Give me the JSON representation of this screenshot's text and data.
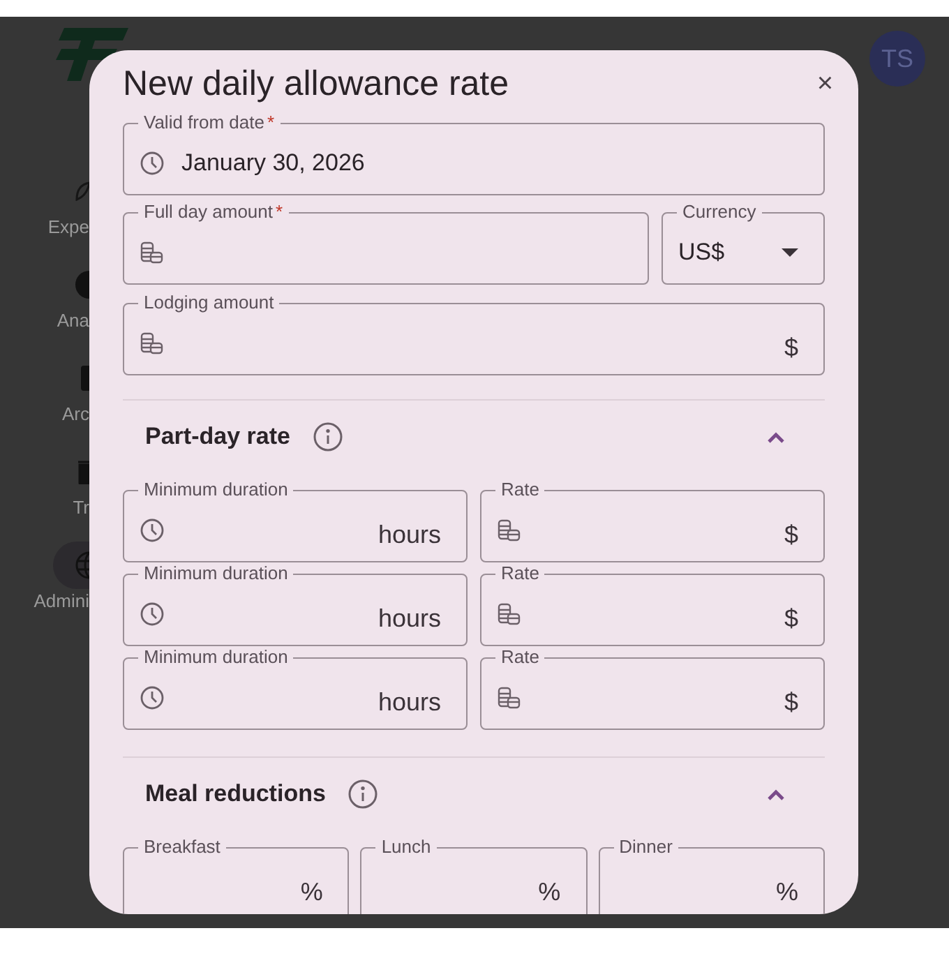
{
  "background": {
    "sidebar_items": [
      {
        "label": "Expe",
        "kind": "leaf",
        "selected": false
      },
      {
        "label": "Ana",
        "kind": "circle",
        "selected": false
      },
      {
        "label": "Arc",
        "kind": "box",
        "selected": false
      },
      {
        "label": "Tr",
        "kind": "trash",
        "selected": false
      },
      {
        "label": "Admini",
        "kind": "globe",
        "selected": true
      }
    ],
    "avatar": "TS"
  },
  "dialog": {
    "title": "New daily allowance rate",
    "close": "×",
    "fields": [
      {
        "kind": "date",
        "label": "Valid from date",
        "required_mark": "*",
        "value": "January 30, 2026"
      },
      {
        "kind": "amount",
        "label": "Full day amount",
        "required_mark": "*"
      },
      {
        "kind": "select",
        "label": "Currency",
        "value": "US$"
      },
      {
        "kind": "amount",
        "label": "Lodging amount",
        "suffix": "$"
      }
    ],
    "sections": [
      {
        "kind": "pairs",
        "title": "Part-day rate",
        "expanded": true,
        "rows": [
          {
            "duration": {
              "label": "Minimum duration",
              "suffix": "hours"
            },
            "rate": {
              "label": "Rate",
              "suffix": "$"
            }
          },
          {
            "duration": {
              "label": "Minimum duration",
              "suffix": "hours"
            },
            "rate": {
              "label": "Rate",
              "suffix": "$"
            }
          },
          {
            "duration": {
              "label": "Minimum duration",
              "suffix": "hours"
            },
            "rate": {
              "label": "Rate",
              "suffix": "$"
            }
          }
        ]
      },
      {
        "kind": "meals",
        "title": "Meal reductions",
        "expanded": true,
        "fields": [
          {
            "label": "Breakfast",
            "suffix": "%"
          },
          {
            "label": "Lunch",
            "suffix": "%"
          },
          {
            "label": "Dinner",
            "suffix": "%"
          }
        ]
      }
    ]
  }
}
